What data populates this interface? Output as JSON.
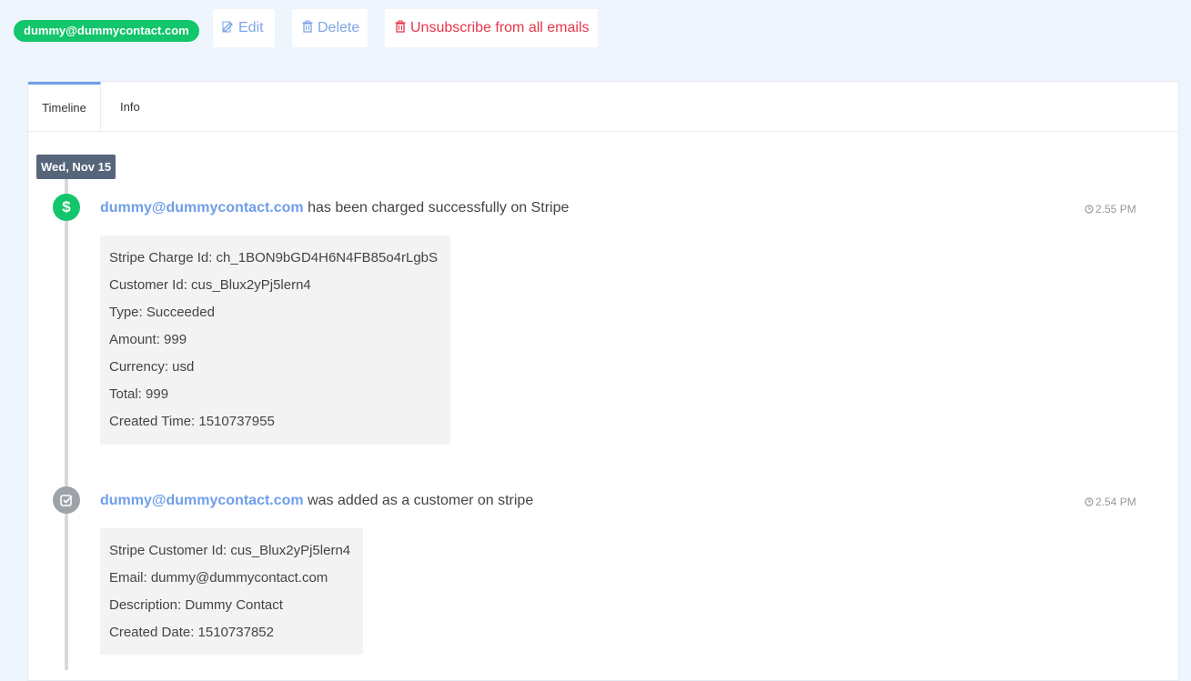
{
  "header": {
    "contact_email": "dummy@dummycontact.com",
    "edit_label": "Edit",
    "delete_label": "Delete",
    "unsubscribe_label": "Unsubscribe from all emails"
  },
  "tabs": [
    {
      "label": "Timeline",
      "active": true
    },
    {
      "label": "Info",
      "active": false
    }
  ],
  "timeline": {
    "date_label": "Wed, Nov 15",
    "events": [
      {
        "icon": "dollar-icon",
        "contact": "dummy@dummycontact.com",
        "message": "has been charged successfully on Stripe",
        "time": "2.55 PM",
        "details": [
          "Stripe Charge Id: ch_1BON9bGD4H6N4FB85o4rLgbS",
          "Customer Id: cus_Blux2yPj5lern4",
          "Type: Succeeded",
          "Amount: 999",
          "Currency: usd",
          "Total: 999",
          "Created Time: 1510737955"
        ]
      },
      {
        "icon": "checkbox-icon",
        "contact": "dummy@dummycontact.com",
        "message": "was added as a customer on stripe",
        "time": "2.54 PM",
        "details": [
          "Stripe Customer Id: cus_Blux2yPj5lern4",
          "Email: dummy@dummycontact.com",
          "Description: Dummy Contact",
          "Created Date: 1510737852"
        ]
      }
    ]
  },
  "colors": {
    "accent": "#6e9ee9",
    "success": "#13c56b",
    "danger": "#e6364b",
    "background": "#eef5fd"
  }
}
